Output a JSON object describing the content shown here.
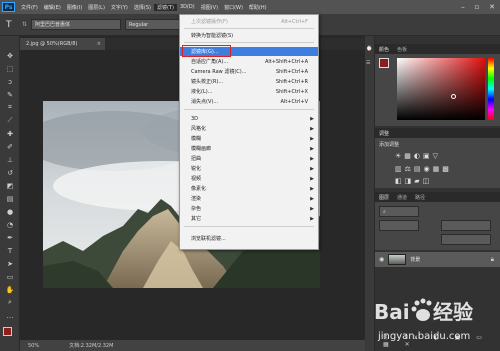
{
  "menubar": {
    "items": [
      "文件(F)",
      "编辑(E)",
      "图像(I)",
      "图层(L)",
      "文字(Y)",
      "选择(S)",
      "滤镜(T)",
      "3D(D)",
      "视图(V)",
      "窗口(W)",
      "帮助(H)"
    ],
    "active": "滤镜(T)"
  },
  "optbar": {
    "font_name": "阿里巴巴普惠体",
    "font_style": "Regular"
  },
  "document": {
    "tab_title": "2.jpg @ 50%(RGB/8)",
    "zoom": "50%",
    "doc_size": "文档:2.32M/2.32M"
  },
  "filter_menu": {
    "items": [
      {
        "label": "上次滤镜操作(F)",
        "shortcut": "Alt+Ctrl+F",
        "disabled": true
      },
      {
        "label": "转换为智能滤镜(S)",
        "shortcut": ""
      },
      {
        "label": "滤镜库(G)...",
        "shortcut": "",
        "highlighted": true
      },
      {
        "label": "自适应广角(A)...",
        "shortcut": "Alt+Shift+Ctrl+A"
      },
      {
        "label": "Camera Raw 滤镜(C)...",
        "shortcut": "Shift+Ctrl+A"
      },
      {
        "label": "镜头校正(R)...",
        "shortcut": "Shift+Ctrl+R"
      },
      {
        "label": "液化(L)...",
        "shortcut": "Shift+Ctrl+X"
      },
      {
        "label": "消失点(V)...",
        "shortcut": "Alt+Ctrl+V"
      },
      {
        "label": "3D",
        "submenu": true
      },
      {
        "label": "风格化",
        "submenu": true
      },
      {
        "label": "模糊",
        "submenu": true
      },
      {
        "label": "模糊画廊",
        "submenu": true
      },
      {
        "label": "扭曲",
        "submenu": true
      },
      {
        "label": "锐化",
        "submenu": true
      },
      {
        "label": "视频",
        "submenu": true
      },
      {
        "label": "像素化",
        "submenu": true
      },
      {
        "label": "渲染",
        "submenu": true
      },
      {
        "label": "杂色",
        "submenu": true
      },
      {
        "label": "其它",
        "submenu": true
      },
      {
        "label": "浏览联机滤镜...",
        "shortcut": ""
      }
    ]
  },
  "panels": {
    "color_tabs": [
      "颜色",
      "色板"
    ],
    "adjust_tab": "调整",
    "adjust_label": "添加调整",
    "layers_tabs": [
      "图层",
      "通道",
      "路径"
    ],
    "layer_name": "背景"
  },
  "watermark": {
    "brand": "Baidu 经验",
    "url": "jingyan.baidu.com"
  },
  "colors": {
    "foreground": "#8b1e1e",
    "highlight": "#3d7ede",
    "red_box": "#e02020"
  }
}
